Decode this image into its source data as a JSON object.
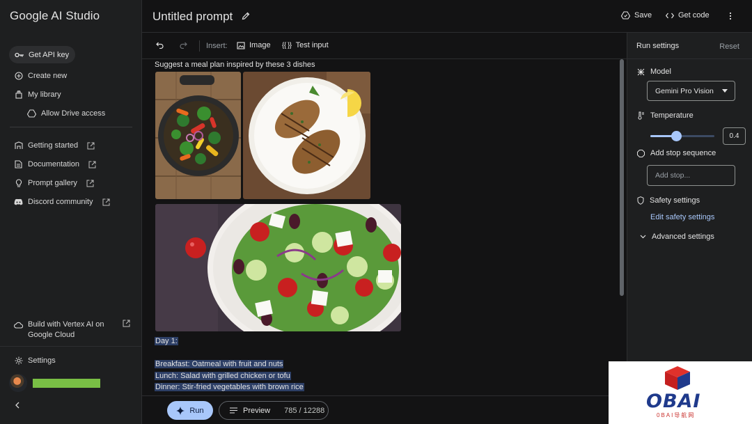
{
  "sidebar": {
    "logo": "Google AI Studio",
    "api_key": "Get API key",
    "items": [
      {
        "label": "Create new"
      },
      {
        "label": "My library"
      },
      {
        "label": "Allow Drive access"
      },
      {
        "label": "Getting started"
      },
      {
        "label": "Documentation"
      },
      {
        "label": "Prompt gallery"
      },
      {
        "label": "Discord community"
      }
    ],
    "vertex_line1": "Build with Vertex AI on",
    "vertex_line2": "Google Cloud",
    "settings": "Settings"
  },
  "header": {
    "title": "Untitled prompt",
    "save": "Save",
    "get_code": "Get code"
  },
  "toolbar": {
    "insert_label": "Insert:",
    "image": "Image",
    "test_input": "Test input",
    "test_input_icon": "{{ }}"
  },
  "main": {
    "prompt": "Suggest a meal plan inspired by these 3 dishes",
    "response": {
      "day": "Day 1:",
      "breakfast": "Breakfast: Oatmeal with fruit and nuts",
      "lunch": "Lunch: Salad with grilled chicken or tofu",
      "dinner": "Dinner: Stir-fried vegetables with brown rice"
    }
  },
  "bottom": {
    "run": "Run",
    "preview": "Preview",
    "count": "785 / 12288"
  },
  "settings": {
    "title": "Run settings",
    "reset": "Reset",
    "model_label": "Model",
    "model_value": "Gemini Pro Vision",
    "temperature_label": "Temperature",
    "temperature_value": "0.4",
    "temperature_fraction": 0.4,
    "stop_label": "Add stop sequence",
    "stop_placeholder": "Add stop...",
    "safety_label": "Safety settings",
    "safety_link": "Edit safety settings",
    "advanced_label": "Advanced settings"
  },
  "watermark": {
    "text": "OBAI",
    "sub": "0BAI导航网"
  },
  "colors": {
    "accent": "#a8c7fa",
    "highlight": "#2d3f66",
    "bg": "#131314",
    "panel": "#1e1f20"
  }
}
